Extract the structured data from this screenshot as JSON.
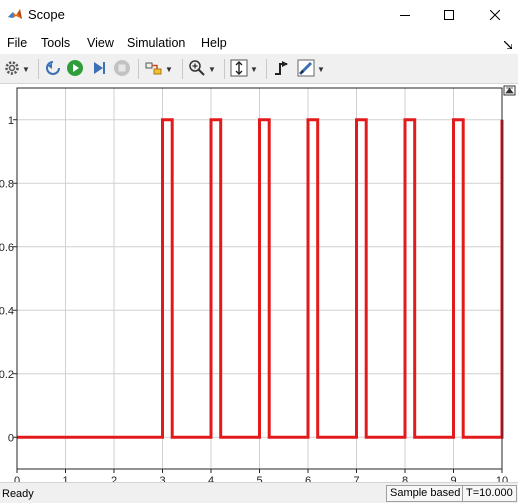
{
  "window": {
    "title": "Scope",
    "icon": "matlab-logo-icon",
    "controls": [
      "minimize-icon",
      "maximize-icon",
      "close-icon"
    ]
  },
  "menubar": {
    "items": [
      "File",
      "Tools",
      "View",
      "Simulation",
      "Help"
    ],
    "dock_icon": "dock-arrow-icon"
  },
  "toolbar": {
    "buttons": [
      {
        "name": "settings",
        "icon": "gear-icon",
        "dropdown": true
      },
      {
        "name": "step-back",
        "icon": "step-back-icon"
      },
      {
        "name": "run",
        "icon": "run-icon"
      },
      {
        "name": "step-forward",
        "icon": "step-forward-icon"
      },
      {
        "name": "stop",
        "icon": "stop-icon",
        "enabled": false
      },
      {
        "name": "highlight",
        "icon": "highlight-signal-icon",
        "dropdown": true
      },
      {
        "name": "zoom",
        "icon": "zoom-in-icon",
        "dropdown": true
      },
      {
        "name": "scale-axes",
        "icon": "scale-axes-icon",
        "dropdown": true
      },
      {
        "name": "triggers",
        "icon": "triggers-icon"
      },
      {
        "name": "measurements",
        "icon": "measurements-icon",
        "dropdown": true
      }
    ]
  },
  "chart_data": {
    "type": "line",
    "title": "",
    "xlabel": "",
    "ylabel": "",
    "xlim": [
      0,
      10
    ],
    "ylim": [
      -0.1,
      1.1
    ],
    "xticks": [
      0,
      1,
      2,
      3,
      4,
      5,
      6,
      7,
      8,
      9,
      10
    ],
    "yticks": [
      0,
      0.2,
      0.4,
      0.6,
      0.8,
      1
    ],
    "ytick_labels": [
      "0",
      "0.2",
      "0.4",
      "0.6",
      "0.8",
      "1"
    ],
    "grid": true,
    "series": [
      {
        "color": "#e31a1c",
        "x": [
          0,
          3,
          3,
          3.2,
          3.2,
          4,
          4,
          4.2,
          4.2,
          5,
          5,
          5.2,
          5.2,
          6,
          6,
          6.2,
          6.2,
          7,
          7,
          7.2,
          7.2,
          8,
          8,
          8.2,
          8.2,
          9,
          9,
          9.2,
          9.2,
          10,
          10
        ],
        "y": [
          0,
          0,
          1,
          1,
          0,
          0,
          1,
          1,
          0,
          0,
          1,
          1,
          0,
          0,
          1,
          1,
          0,
          0,
          1,
          1,
          0,
          0,
          1,
          1,
          0,
          0,
          1,
          1,
          0,
          0,
          1
        ]
      }
    ]
  },
  "plot": {
    "background": "#ffffff",
    "grid_color": "#d0d0d0",
    "axis_color": "#262626",
    "undock_icon": "undock-axes-icon"
  },
  "status": {
    "text": "Ready",
    "sample_mode": "Sample based",
    "time": "T=10.000"
  }
}
